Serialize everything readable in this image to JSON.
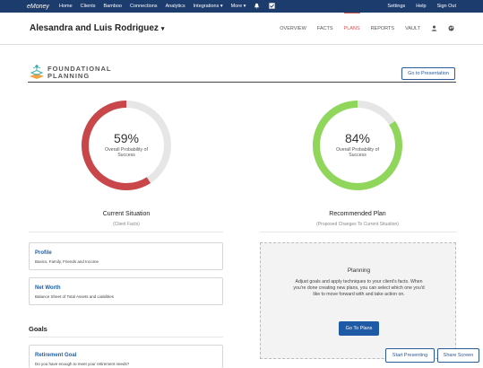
{
  "topnav": {
    "logo": "eMoney",
    "items": [
      "Home",
      "Clients",
      "Bamboo",
      "Connections",
      "Analytics",
      "Integrations ▾",
      "More ▾"
    ],
    "icons": [
      "bell-icon",
      "checkbox-icon"
    ],
    "right": [
      "Settings",
      "Help",
      "Sign Out"
    ]
  },
  "client": {
    "name": "Alesandra and Luis Rodriguez",
    "caret": "▾",
    "tabs": [
      "OVERVIEW",
      "FACTS",
      "PLANS",
      "REPORTS",
      "VAULT"
    ],
    "active_tab": "PLANS",
    "tab_icons": [
      "user-icon",
      "globe-icon"
    ]
  },
  "planning": {
    "title_line1": "FOUNDATIONAL",
    "title_line2": "PLANNING",
    "presentation_button": "Go to Presentation"
  },
  "current": {
    "percent_label": "59%",
    "percent": 59,
    "prob_label": "Overall Probability of Success",
    "title": "Current Situation",
    "subtitle": "(Client Facts)",
    "color": "#c9474a"
  },
  "recommended": {
    "percent_label": "84%",
    "percent": 84,
    "prob_label": "Overall Probability of Success",
    "title": "Recommended Plan",
    "subtitle": "(Proposed Changes To Current Situation)",
    "color": "#8fd65a"
  },
  "cards": [
    {
      "title": "Profile",
      "desc": "Basics, Family, Friends and Income"
    },
    {
      "title": "Net Worth",
      "desc": "Balance Sheet of Total Assets and Liabilities"
    }
  ],
  "goals": {
    "title": "Goals",
    "card_title": "Retirement Goal",
    "card_desc": "Do you have enough to meet your retirement needs?"
  },
  "plan_box": {
    "title": "Planning",
    "text": "Adjust goals and apply techniques to your client's facts. When you're done creating new plans, you can select which one you'd like to move forward with and take action on.",
    "button": "Go To Plans"
  },
  "footer_buttons": {
    "start": "Start Presenting",
    "share": "Share Screen"
  }
}
